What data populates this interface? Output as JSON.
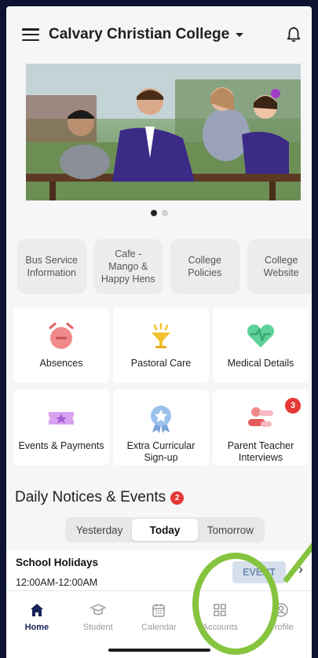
{
  "header": {
    "title": "Calvary Christian College"
  },
  "carousel": {
    "dots": 2,
    "active_index": 0
  },
  "quick_links": [
    {
      "label": "Bus Service\nInformation"
    },
    {
      "label": "Cafe -\nMango &\nHappy Hens"
    },
    {
      "label": "College\nPolicies"
    },
    {
      "label": "College\nWebsite"
    }
  ],
  "tiles": [
    {
      "label": "Absences",
      "icon": "alarm-clock-icon"
    },
    {
      "label": "Pastoral Care",
      "icon": "trophy-icon"
    },
    {
      "label": "Medical Details",
      "icon": "heart-icon"
    },
    {
      "label": "Events & Payments",
      "icon": "ticket-icon"
    },
    {
      "label": "Extra Curricular\nSign-up",
      "icon": "award-ribbon-icon"
    },
    {
      "label": "Parent Teacher\nInterviews",
      "icon": "people-icon",
      "badge": "3"
    }
  ],
  "notices": {
    "title": "Daily Notices & Events",
    "badge": "2",
    "tabs": [
      "Yesterday",
      "Today",
      "Tomorrow"
    ],
    "active_tab": "Today",
    "event": {
      "title": "School Holidays",
      "time": "12:00AM-12:00AM",
      "tag": "EVENT"
    }
  },
  "tabbar": [
    {
      "label": "Home",
      "icon": "home-icon",
      "active": true
    },
    {
      "label": "Student",
      "icon": "graduation-cap-icon"
    },
    {
      "label": "Calendar",
      "icon": "calendar-icon"
    },
    {
      "label": "Accounts",
      "icon": "grid-icon"
    },
    {
      "label": "Profile",
      "icon": "profile-circle-icon"
    }
  ],
  "colors": {
    "accent": "#16235a",
    "badge": "#e53935",
    "annotation": "#86c440",
    "frame": "#0d1330"
  }
}
